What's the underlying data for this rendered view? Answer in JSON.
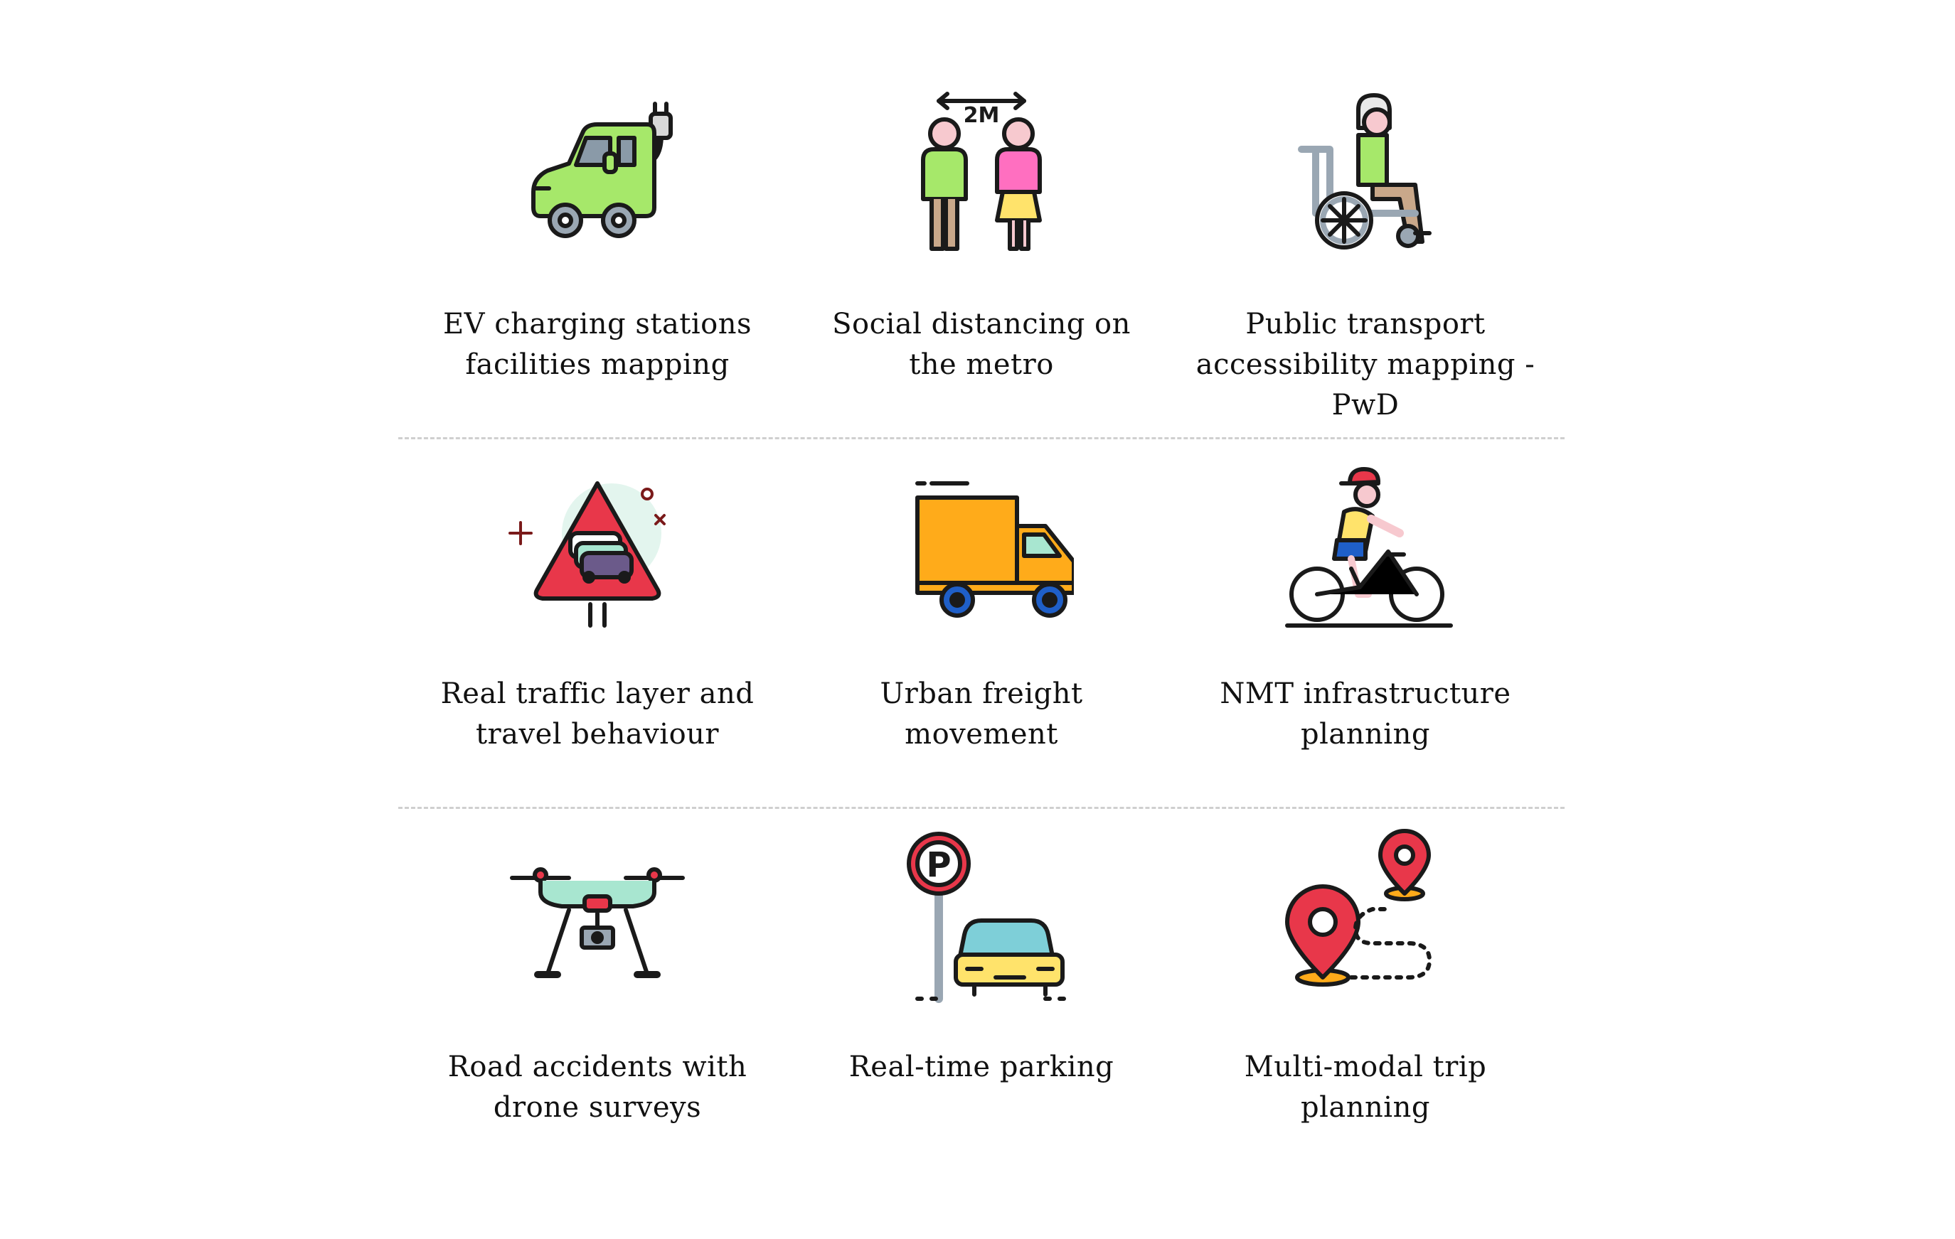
{
  "items": [
    {
      "icon": "ev-charging-car-icon",
      "line1": "EV charging stations",
      "line2": "facilities mapping"
    },
    {
      "icon": "social-distancing-icon",
      "line1": "Social distancing on",
      "line2": "the metro",
      "icon_text": "2M"
    },
    {
      "icon": "wheelchair-icon",
      "line1": "Public transport",
      "line2": "accessibility mapping - PwD"
    },
    {
      "icon": "traffic-warning-sign-icon",
      "line1": "Real traffic layer and",
      "line2": "travel behaviour"
    },
    {
      "icon": "delivery-truck-icon",
      "line1": "Urban freight",
      "line2": "movement"
    },
    {
      "icon": "cyclist-icon",
      "line1": "NMT infrastructure",
      "line2": "planning"
    },
    {
      "icon": "drone-icon",
      "line1": "Road accidents with",
      "line2": "drone surveys"
    },
    {
      "icon": "parking-sign-car-icon",
      "line1": "Real-time parking",
      "line2": "",
      "icon_text": "P"
    },
    {
      "icon": "map-pins-route-icon",
      "line1": "Multi-modal trip",
      "line2": "planning"
    }
  ],
  "colors": {
    "divider": "#cfcfcf",
    "outline": "#1a1a1a",
    "green": "#a6e86a",
    "pink": "#ff6fc0",
    "red": "#e8374a",
    "orange": "#ffab1a",
    "blue": "#1f5fc8",
    "mint": "#a8e6d0",
    "teal": "#7ecfd8",
    "yellow": "#ffe36b"
  }
}
